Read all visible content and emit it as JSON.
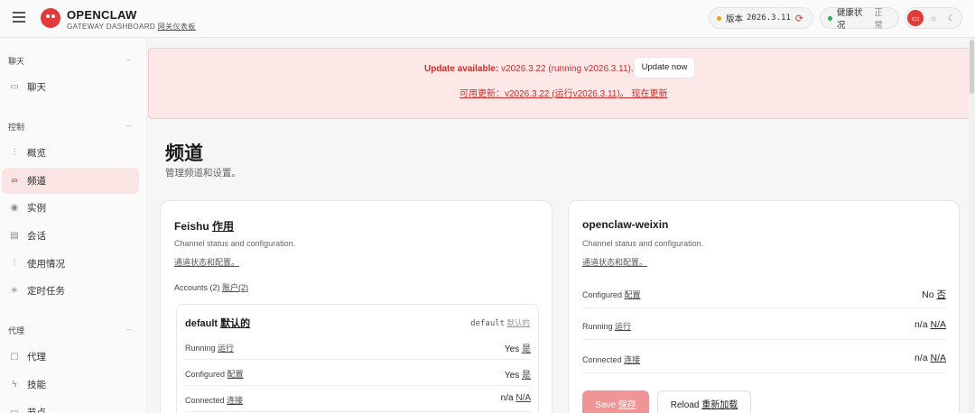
{
  "header": {
    "brand_title": "OPENCLAW",
    "brand_sub_en": "GATEWAY DASHBOARD",
    "brand_sub_cn": "网关仪表板",
    "version_label": "版本",
    "version_value": "2026.3.11",
    "health_label": "健康状况",
    "health_value": "正常",
    "colors": {
      "accent": "#e23b3b",
      "version_dot": "#f0a020",
      "health_dot": "#2cb05a"
    },
    "icons": [
      "menu-icon",
      "logo-icon",
      "refresh-icon",
      "monitor-icon",
      "sun-icon",
      "moon-icon"
    ]
  },
  "sidebar": {
    "groups": [
      {
        "title": "聊天",
        "items": [
          {
            "label": "聊天",
            "icon": "chat-icon"
          }
        ]
      },
      {
        "title": "控制",
        "items": [
          {
            "label": "概览",
            "icon": "bar-chart-icon"
          },
          {
            "label": "频道",
            "icon": "link-icon",
            "active": true
          },
          {
            "label": "实例",
            "icon": "radio-icon"
          },
          {
            "label": "会话",
            "icon": "document-icon"
          },
          {
            "label": "使用情况",
            "icon": "bar-chart-icon"
          },
          {
            "label": "定时任务",
            "icon": "loader-icon"
          }
        ]
      },
      {
        "title": "代理",
        "items": [
          {
            "label": "代理",
            "icon": "folder-icon"
          },
          {
            "label": "技能",
            "icon": "zap-icon"
          },
          {
            "label": "节点",
            "icon": "monitor-icon"
          }
        ]
      }
    ]
  },
  "banner": {
    "line1_bold": "Update available:",
    "line1_rest": "v2026.3.22 (running v2026.3.11).",
    "update_button": "Update now",
    "line2": "可用更新：v2026.3.22 (运行v2026.3.11)。 现在更新"
  },
  "page": {
    "title": "频道",
    "subtitle": "管理频道和设置。"
  },
  "card_left": {
    "title": "Feishu",
    "title_cn": "作用",
    "desc": "Channel status and configuration.",
    "desc_cn": "通道状态和配置。",
    "accounts_label": "Accounts (2)",
    "accounts_label_cn": "账户(2)",
    "account": {
      "title": "default",
      "title_cn": "默认的",
      "id": "default",
      "id_cn": "默认的",
      "rows": [
        {
          "key": "Running",
          "key_cn": "运行",
          "value": "Yes",
          "value_cn": "是"
        },
        {
          "key": "Configured",
          "key_cn": "配置",
          "value": "Yes",
          "value_cn": "是"
        },
        {
          "key": "Connected",
          "key_cn": "连接",
          "value": "n/a",
          "value_cn": "N/A"
        }
      ]
    }
  },
  "card_right": {
    "title": "openclaw-weixin",
    "desc": "Channel status and configuration.",
    "desc_cn": "通道状态和配置。",
    "rows": [
      {
        "key": "Configured",
        "key_cn": "配置",
        "value": "No",
        "value_cn": "否"
      },
      {
        "key": "Running",
        "key_cn": "运行",
        "value": "n/a",
        "value_cn": "N/A"
      },
      {
        "key": "Connected",
        "key_cn": "连接",
        "value": "n/a",
        "value_cn": "N/A"
      }
    ],
    "save_label": "Save",
    "save_label_cn": "保存",
    "reload_label": "Reload",
    "reload_label_cn": "重新加载"
  }
}
